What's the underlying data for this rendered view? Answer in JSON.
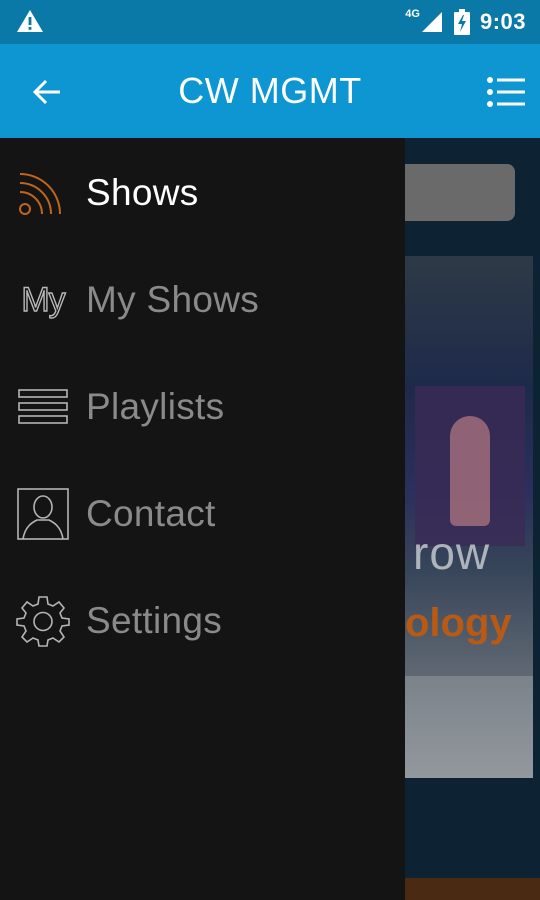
{
  "status_bar": {
    "network_label": "4G",
    "time": "9:03"
  },
  "app_bar": {
    "title": "CW MGMT"
  },
  "drawer": {
    "items": [
      {
        "label": "Shows",
        "icon": "rss-icon",
        "active": true
      },
      {
        "label": "My Shows",
        "icon": "my-icon",
        "icon_text": "My",
        "active": false
      },
      {
        "label": "Playlists",
        "icon": "list-icon",
        "active": false
      },
      {
        "label": "Contact",
        "icon": "contact-icon",
        "active": false
      },
      {
        "label": "Settings",
        "icon": "gear-icon",
        "active": false
      }
    ]
  },
  "background": {
    "banner_word_1": "row",
    "banner_word_2": "ology"
  },
  "colors": {
    "status_bar": "#0a79a8",
    "app_bar": "#0d96d1",
    "drawer": "#141414",
    "accent": "#d2691e"
  }
}
